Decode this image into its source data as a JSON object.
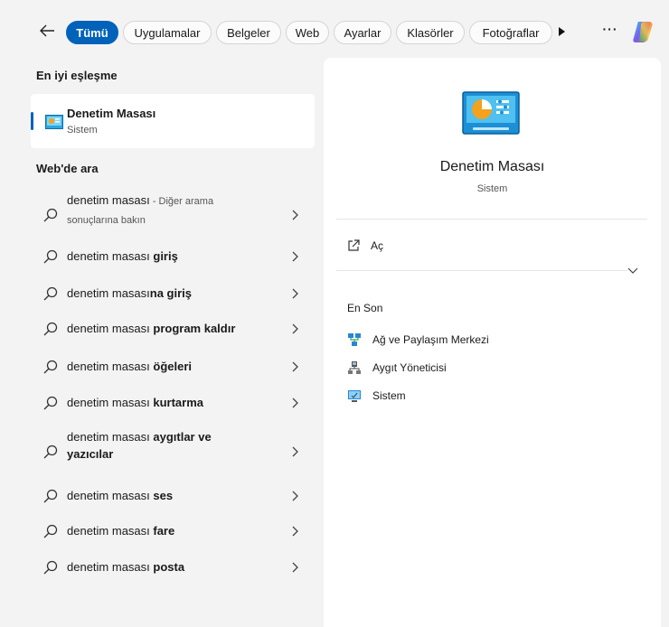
{
  "filters": {
    "back_icon": "arrow-left-icon",
    "tabs": [
      {
        "label": "Tümü",
        "active": true
      },
      {
        "label": "Uygulamalar"
      },
      {
        "label": "Belgeler"
      },
      {
        "label": "Web"
      },
      {
        "label": "Ayarlar"
      },
      {
        "label": "Klasörler"
      },
      {
        "label": "Fotoğraflar"
      }
    ],
    "more_label": "···"
  },
  "best_match": {
    "section_title": "En iyi eşleşme",
    "title": "Denetim Masası",
    "subtitle": "Sistem"
  },
  "web": {
    "section_title": "Web'de ara",
    "items": [
      {
        "prefix": "denetim masası",
        "bold": "",
        "note": " - Diğer arama",
        "note2": "sonuçlarına bakın"
      },
      {
        "prefix": "denetim masası ",
        "bold": "giriş"
      },
      {
        "prefix": "denetim masası",
        "bold": "na giriş"
      },
      {
        "prefix": "denetim masası ",
        "bold": "program kaldır"
      },
      {
        "prefix": "denetim masası ",
        "bold": "öğeleri"
      },
      {
        "prefix": "denetim masası ",
        "bold": "kurtarma"
      },
      {
        "prefix": "denetim masası ",
        "bold": "aygıtlar ve",
        "bold2": "yazıcılar"
      },
      {
        "prefix": "denetim masası ",
        "bold": "ses"
      },
      {
        "prefix": "denetim masası ",
        "bold": "fare"
      },
      {
        "prefix": "denetim masası ",
        "bold": "posta"
      }
    ]
  },
  "detail": {
    "title": "Denetim Masası",
    "subtitle": "Sistem",
    "open_label": "Aç",
    "recent_title": "En Son",
    "recent": [
      {
        "label": "Ağ ve Paylaşım Merkezi",
        "icon": "network-center-icon"
      },
      {
        "label": "Aygıt Yöneticisi",
        "icon": "device-manager-icon"
      },
      {
        "label": "Sistem",
        "icon": "system-icon"
      }
    ]
  },
  "colors": {
    "accent": "#0062b8",
    "pane_bg": "#f3f3f3",
    "card_bg": "#ffffff"
  }
}
